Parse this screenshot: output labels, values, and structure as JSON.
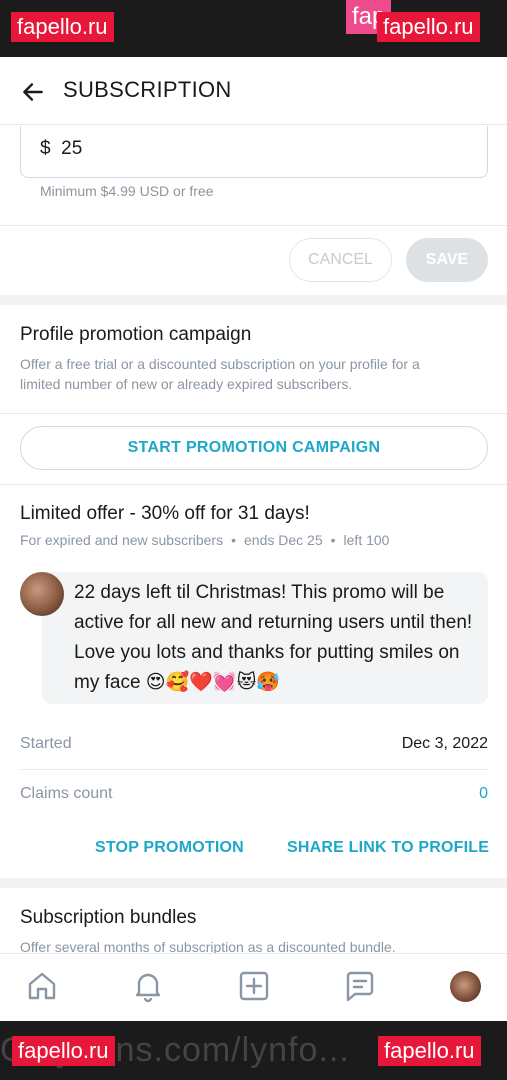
{
  "watermark": {
    "text": "fapello.ru",
    "partial": "fap"
  },
  "header": {
    "title": "SUBSCRIPTION"
  },
  "price": {
    "currency": "$",
    "value": "25",
    "minimum": "Minimum $4.99 USD or free"
  },
  "actions": {
    "cancel": "CANCEL",
    "save": "SAVE"
  },
  "promotion": {
    "title": "Profile promotion campaign",
    "description": "Offer a free trial or a discounted subscription on your profile for a limited number of new or already expired subscribers.",
    "start_button": "START PROMOTION CAMPAIGN"
  },
  "offer": {
    "title": "Limited offer - 30% off for 31 days!",
    "audience": "For expired and new subscribers",
    "ends": "ends Dec 25",
    "left": "left 100",
    "message": "22 days left til Christmas! This promo will be active for all new and returning users until then! Love you lots and thanks for putting smiles on my face 😍🥰❤️💓😻🥵",
    "started_label": "Started",
    "started_value": "Dec 3, 2022",
    "claims_label": "Claims count",
    "claims_value": "0",
    "stop_button": "STOP PROMOTION",
    "share_button": "SHARE LINK TO PROFILE"
  },
  "bundles": {
    "title": "Subscription bundles",
    "description": "Offer several months of subscription as a discounted bundle."
  },
  "nav": {
    "icons": [
      "home-icon",
      "bell-icon",
      "add-post-icon",
      "messages-icon",
      "profile-avatar"
    ]
  },
  "footer": {
    "text": "OnlyFans.com/lynfo..."
  },
  "colors": {
    "accent": "#1ea8c8",
    "muted": "#8a96a3",
    "watermark": "#e8173a"
  }
}
